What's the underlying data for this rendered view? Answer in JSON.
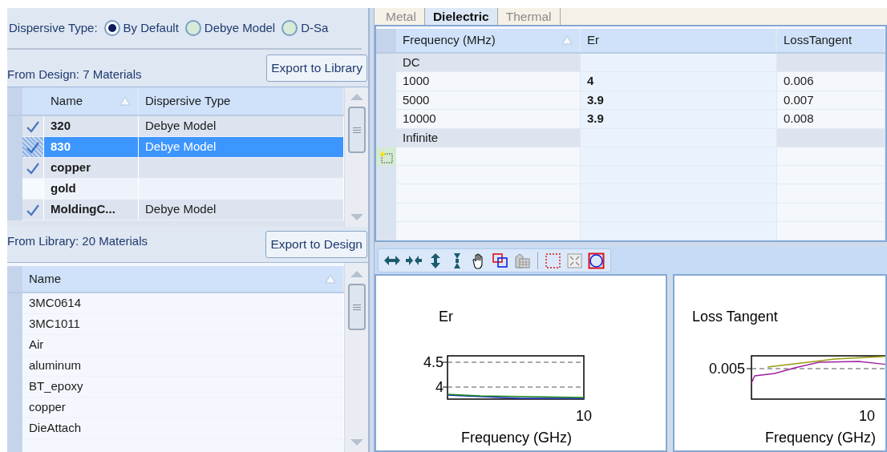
{
  "dispersive_type": {
    "label": "Dispersive Type:",
    "options": [
      {
        "label": "By Default",
        "selected": true
      },
      {
        "label": "Debye Model",
        "selected": false
      },
      {
        "label": "D-Sa",
        "selected": false
      }
    ]
  },
  "design": {
    "label": "From Design: 7 Materials",
    "button": "Export to Library",
    "columns": [
      "Name",
      "Dispersive Type"
    ],
    "rows": [
      {
        "name": "320",
        "dispersive_type": "Debye Model",
        "checked": true,
        "selected": false
      },
      {
        "name": "830",
        "dispersive_type": "Debye Model",
        "checked": true,
        "selected": true
      },
      {
        "name": "copper",
        "checked": true,
        "selected": false
      },
      {
        "name": "gold",
        "checked": false,
        "selected": false
      },
      {
        "name": "MoldingC...",
        "dispersive_type": "Debye Model",
        "checked": true,
        "selected": false
      }
    ]
  },
  "library": {
    "label": "From Library: 20 Materials",
    "button": "Export to Design",
    "columns": [
      "Name"
    ],
    "rows": [
      {
        "name": "3MC0614"
      },
      {
        "name": "3MC1011"
      },
      {
        "name": "Air"
      },
      {
        "name": "aluminum"
      },
      {
        "name": "BT_epoxy"
      },
      {
        "name": "copper"
      },
      {
        "name": "DieAttach"
      }
    ]
  },
  "tabs": [
    {
      "label": "Metal",
      "selected": false
    },
    {
      "label": "Dielectric",
      "selected": true
    },
    {
      "label": "Thermal",
      "selected": false
    }
  ],
  "properties_table": {
    "columns": [
      "Frequency (MHz)",
      "Er",
      "LossTangent"
    ],
    "rows": [
      {
        "kind": "limit",
        "frequency": "DC"
      },
      {
        "kind": "data",
        "frequency": "1000",
        "er": "4",
        "loss_tangent": "0.006"
      },
      {
        "kind": "data",
        "frequency": "5000",
        "er": "3.9",
        "loss_tangent": "0.007"
      },
      {
        "kind": "data",
        "frequency": "10000",
        "er": "3.9",
        "loss_tangent": "0.008"
      },
      {
        "kind": "limit",
        "frequency": "Infinite"
      }
    ]
  },
  "plots": [
    {
      "title": "Er",
      "ytick_labels": [
        "4.5",
        "4"
      ],
      "xtick_label": "10",
      "xlabel": "Frequency (GHz)"
    },
    {
      "title": "Loss Tangent",
      "ytick_labels": [
        "0.005"
      ],
      "xtick_label": "10",
      "xlabel": "Frequency (GHz)"
    }
  ]
}
